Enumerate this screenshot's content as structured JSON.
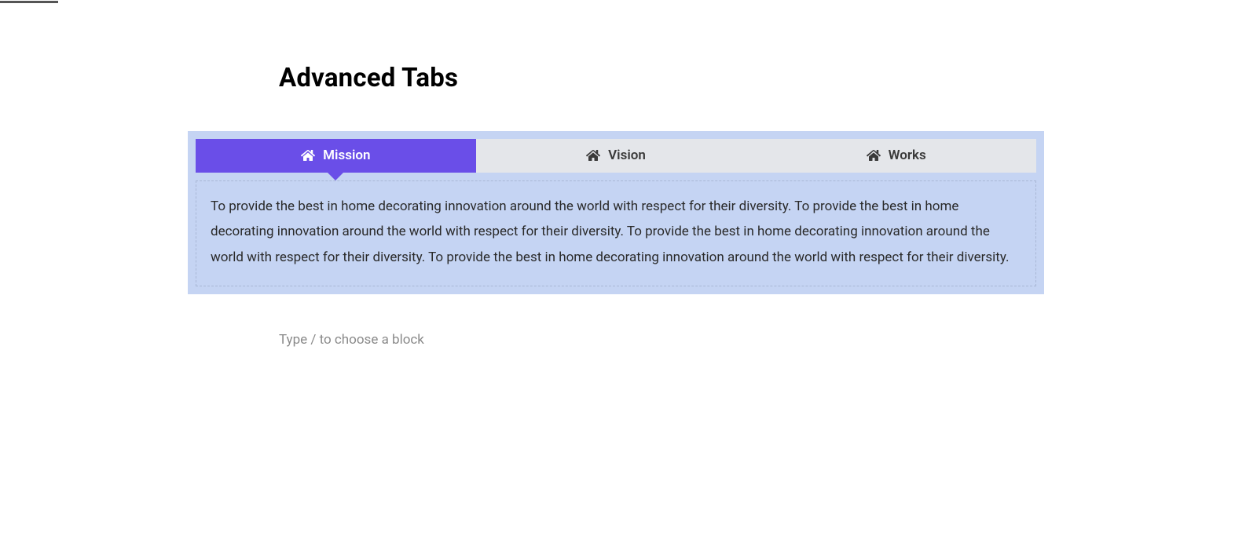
{
  "heading": "Advanced Tabs",
  "tabs": [
    {
      "label": "Mission",
      "active": true
    },
    {
      "label": "Vision",
      "active": false
    },
    {
      "label": "Works",
      "active": false
    }
  ],
  "tab_content": "To provide the best in home decorating innovation around the world with respect for their diversity. To provide the best in home decorating innovation around the world with respect for their diversity. To provide the best in home decorating innovation around the world with respect for their diversity. To provide the best in home decorating innovation around the world with respect for their diversity.",
  "block_placeholder": "Type / to choose a block",
  "colors": {
    "accent": "#6a4ee8",
    "panel_bg": "#c5d4f3",
    "inactive_tab": "#e4e6ea"
  }
}
